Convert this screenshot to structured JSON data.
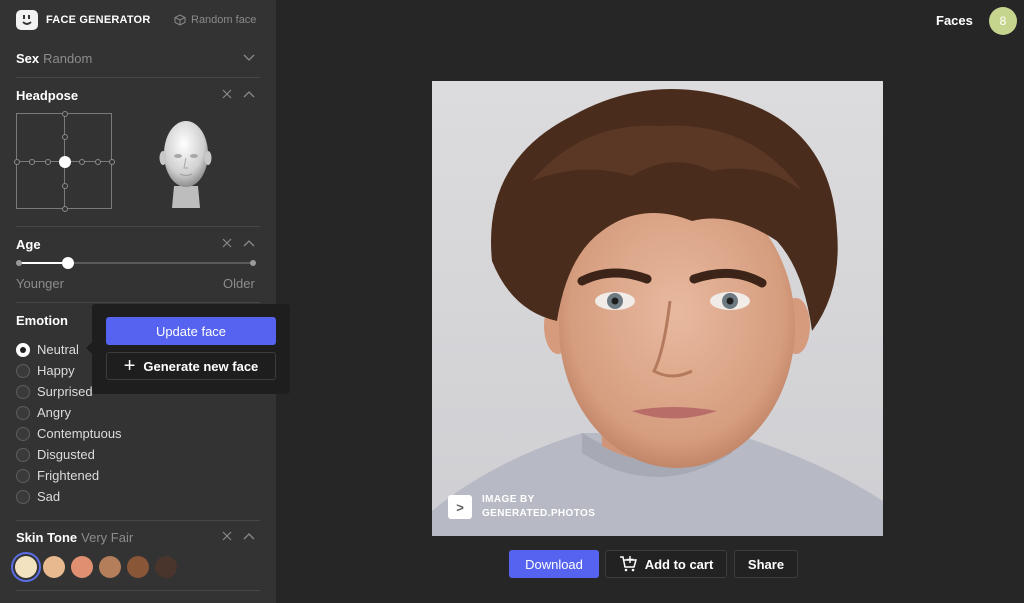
{
  "brand": {
    "name": "FACE GENERATOR",
    "random_label": "Random face"
  },
  "sex": {
    "title": "Sex",
    "value": "Random"
  },
  "headpose": {
    "title": "Headpose"
  },
  "age": {
    "title": "Age",
    "min_label": "Younger",
    "max_label": "Older",
    "level": 0.21
  },
  "emotion": {
    "title": "Emotion",
    "options": [
      "Neutral",
      "Happy",
      "Surprised",
      "Angry",
      "Contemptuous",
      "Disgusted",
      "Frightened",
      "Sad"
    ],
    "selected": "Neutral"
  },
  "popover": {
    "update_label": "Update face",
    "generate_label": "Generate new face",
    "plus_glyph": "+"
  },
  "skin_tone": {
    "title": "Skin Tone",
    "value": "Very Fair",
    "swatches": [
      "#f3e2c0",
      "#e8b98f",
      "#e09071",
      "#b47e5a",
      "#8a5638",
      "#4a352c"
    ],
    "selected_index": 0
  },
  "header": {
    "faces_label": "Faces",
    "faces_count": "8"
  },
  "image": {
    "watermark_glyph": ">",
    "watermark_line1": "IMAGE BY",
    "watermark_line2": "GENERATED.PHOTOS"
  },
  "actions": {
    "download_label": "Download",
    "cart_label": "Add to cart",
    "share_label": "Share"
  },
  "colors": {
    "accent": "#5663f0",
    "sidebar_bg": "#333333",
    "page_bg": "#262626",
    "badge": "#c6d58d"
  }
}
